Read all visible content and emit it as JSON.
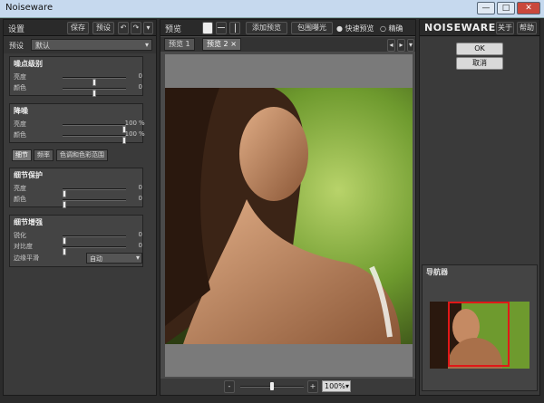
{
  "window": {
    "title": "Noiseware",
    "min_label": "—",
    "max_label": "□",
    "close_label": "✕"
  },
  "left": {
    "settings_title": "设置",
    "save_label": "保存",
    "preset_label": "预设",
    "undo_label": "↶",
    "redo_label": "↷",
    "menu_label": "▾",
    "preset_row_label": "预设",
    "preset_value": "默认",
    "noise_level": {
      "title": "噪点级别",
      "rows": [
        {
          "label": "亮度",
          "value": "0",
          "level": 0.5
        },
        {
          "label": "颜色",
          "value": "0",
          "level": 0.5
        }
      ]
    },
    "denoise": {
      "title": "降噪",
      "rows": [
        {
          "label": "亮度",
          "value": "100",
          "unit": "%",
          "level": 1.0
        },
        {
          "label": "颜色",
          "value": "100",
          "unit": "%",
          "level": 1.0
        }
      ]
    },
    "tabs": [
      "细节",
      "频率",
      "色调和色彩范围"
    ],
    "detail_protection": {
      "title": "细节保护",
      "rows": [
        {
          "label": "亮度",
          "value": "0",
          "level": 0.0
        },
        {
          "label": "颜色",
          "value": "0",
          "level": 0.0
        }
      ]
    },
    "detail_enhance": {
      "title": "细节增强",
      "rows": [
        {
          "label": "锐化",
          "value": "0",
          "level": 0.0
        },
        {
          "label": "对比度",
          "value": "0",
          "level": 0.0
        }
      ],
      "edge_label": "边缘平滑",
      "edge_value": "自动"
    }
  },
  "center": {
    "title": "预览",
    "add_preview_label": "添加预览",
    "clip_label": "包围曝光",
    "fast_preview_label": "快速预览",
    "accurate_label": "精确",
    "tabs": [
      "预览 1",
      "预览 2"
    ],
    "zoom_minus": "-",
    "zoom_plus": "+",
    "zoom_value": "100%",
    "zoom_level": 0.5,
    "colors": {
      "photo_bg": "#7fa83a",
      "skin": "#c58a63",
      "hair": "#3b2416"
    }
  },
  "right": {
    "logo": "NOISEWARE 5",
    "about_label": "关于",
    "help_label": "帮助",
    "ok_label": "OK",
    "cancel_label": "取消",
    "navigator_title": "导航器",
    "accent": "#e01818"
  }
}
